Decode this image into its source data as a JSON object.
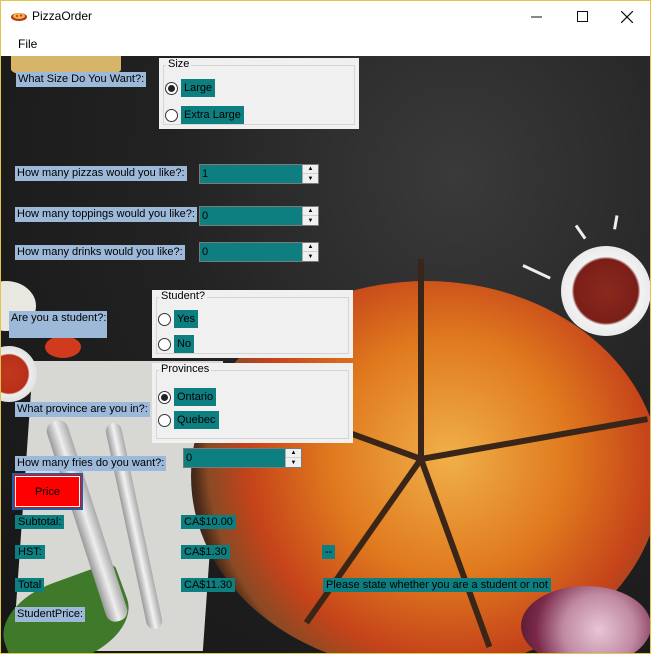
{
  "window": {
    "title": "PizzaOrder"
  },
  "menu": {
    "file": "File"
  },
  "size": {
    "question": "What Size Do You Want?:",
    "group_title": "Size",
    "options": [
      "Large",
      "Extra Large"
    ],
    "selected": "Large"
  },
  "pizzas": {
    "question": "How many pizzas would you like?:",
    "value": "1"
  },
  "toppings": {
    "question": "How many toppings would you like?:",
    "value": "0"
  },
  "drinks": {
    "question": "How many drinks would you like?:",
    "value": "0"
  },
  "student": {
    "question": "Are you a student?:",
    "group_title": "Student?",
    "options": [
      "Yes",
      "No"
    ],
    "selected": ""
  },
  "province": {
    "question": "What province are you in?:",
    "group_title": "Provinces",
    "options": [
      "Ontario",
      "Quebec"
    ],
    "selected": "Ontario"
  },
  "fries": {
    "question": "How many fries do you want?:",
    "value": "0"
  },
  "price_button": "Price",
  "totals": {
    "subtotal_label": "Subtotal:",
    "subtotal_value": "CA$10.00",
    "hst_label": "HST:",
    "hst_value": "CA$1.30",
    "hst_extra": "--",
    "total_label": "Total",
    "total_value": "CA$11.30",
    "message": "Please state whether you are a student or not",
    "student_price_label": "StudentPrice:"
  },
  "colors": {
    "label_bg": "#9db9d9",
    "teal_bg": "#0d7f80",
    "price_button_bg": "#ff0000"
  }
}
